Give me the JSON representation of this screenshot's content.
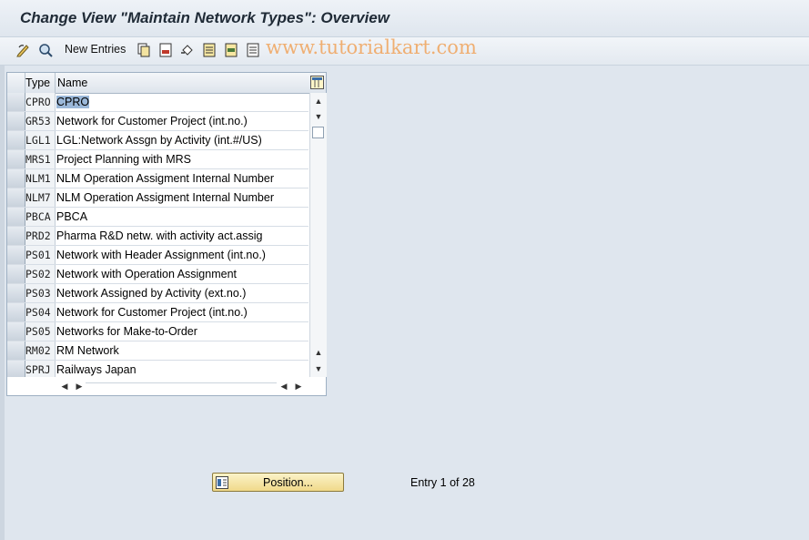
{
  "window": {
    "title": "Change View \"Maintain Network Types\": Overview"
  },
  "toolbar": {
    "new_entries_label": "New Entries",
    "watermark": "www.tutorialkart.com",
    "icons": [
      "display-change-icon",
      "details-icon",
      "copy-icon",
      "delete-icon",
      "undo-icon",
      "select-all-icon",
      "select-block-icon",
      "deselect-all-icon"
    ]
  },
  "table": {
    "columns": {
      "type": "Type",
      "name": "Name"
    },
    "rows": [
      {
        "type": "CPRO",
        "name": "CPRO"
      },
      {
        "type": "GR53",
        "name": "Network for Customer Project (int.no.)"
      },
      {
        "type": "LGL1",
        "name": "LGL:Network Assgn by Activity (int.#/US)"
      },
      {
        "type": "MRS1",
        "name": "Project Planning with MRS"
      },
      {
        "type": "NLM1",
        "name": "NLM Operation Assigment  Internal Number"
      },
      {
        "type": "NLM7",
        "name": "NLM Operation Assigment  Internal Number"
      },
      {
        "type": "PBCA",
        "name": "PBCA"
      },
      {
        "type": "PRD2",
        "name": "Pharma R&D netw. with activity act.assig"
      },
      {
        "type": "PS01",
        "name": "Network with Header Assignment (int.no.)"
      },
      {
        "type": "PS02",
        "name": "Network with Operation Assignment"
      },
      {
        "type": "PS03",
        "name": "Network Assigned by Activity (ext.no.)"
      },
      {
        "type": "PS04",
        "name": "Network for Customer Project (int.no.)"
      },
      {
        "type": "PS05",
        "name": "Networks for Make-to-Order"
      },
      {
        "type": "RM02",
        "name": "RM Network"
      },
      {
        "type": "SPRJ",
        "name": "Railways Japan"
      }
    ]
  },
  "footer": {
    "position_label": "Position...",
    "entry_text": "Entry 1 of 28"
  }
}
